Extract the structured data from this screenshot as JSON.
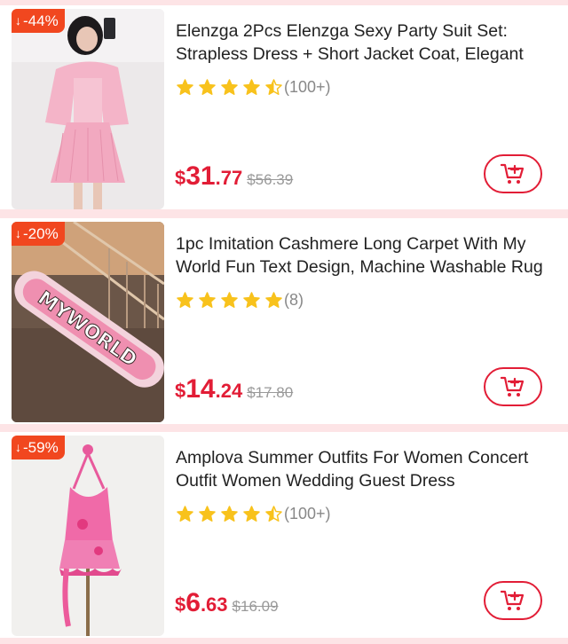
{
  "products": [
    {
      "discount": "-44%",
      "title": "Elenzga 2Pcs Elenzga Sexy Party Suit Set: Strapless Dress + Short Jacket Coat, Elegant",
      "rating": 4.5,
      "review_count": "(100+)",
      "price_symbol": "$",
      "price_int": "31",
      "price_dec": ".77",
      "original_price": "$56.39"
    },
    {
      "discount": "-20%",
      "title": "1pc Imitation Cashmere Long Carpet With My World Fun Text Design, Machine Washable Rug",
      "rating": 5,
      "review_count": "(8)",
      "price_symbol": "$",
      "price_int": "14",
      "price_dec": ".24",
      "original_price": "$17.80",
      "image_text": "MYWORLD"
    },
    {
      "discount": "-59%",
      "title": "Amplova Summer Outfits For Women Concert Outfit Women Wedding Guest Dress",
      "rating": 4.5,
      "review_count": "(100+)",
      "price_symbol": "$",
      "price_int": "6",
      "price_dec": ".63",
      "original_price": "$16.09"
    }
  ],
  "icons": {
    "discount_arrow": "arrow-down-icon",
    "star": "star-icon",
    "cart": "add-to-cart-icon"
  },
  "colors": {
    "price": "#e21d36",
    "badge": "#f1471f",
    "star": "#f8c21c",
    "background": "#fde4e6"
  }
}
